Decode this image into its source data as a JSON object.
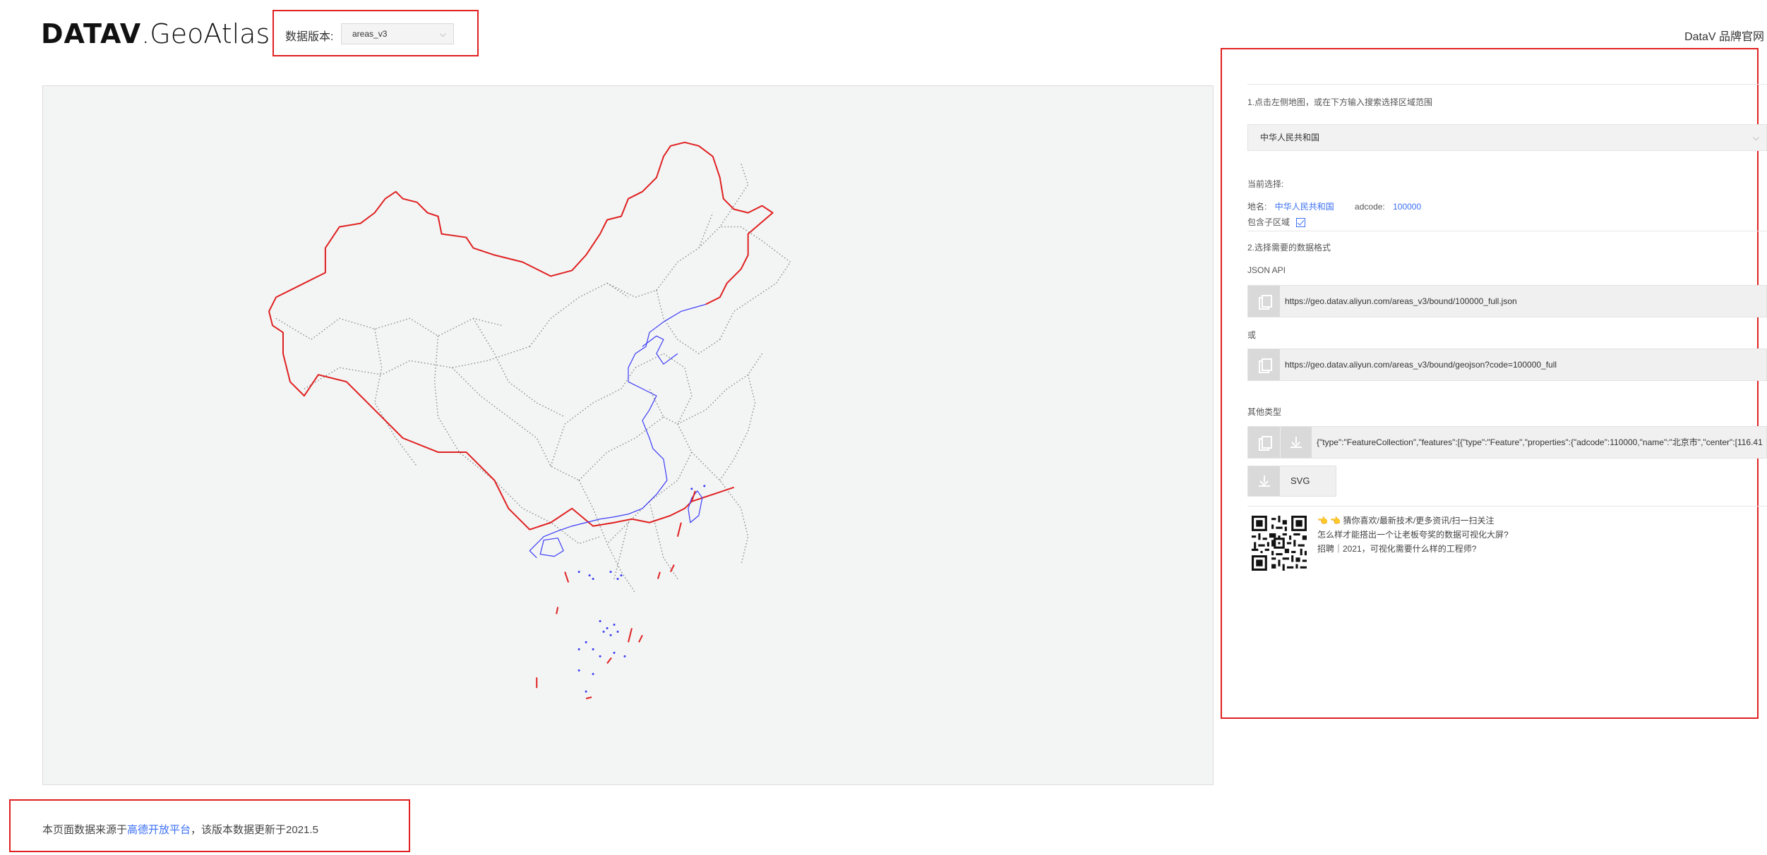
{
  "header": {
    "logo_bold": "DATAV",
    "logo_light": ".GeoAtlas",
    "version_label": "数据版本:",
    "version_value": "areas_v3",
    "brand_link": "DataV 品牌官网"
  },
  "panel": {
    "step1": "1.点击左侧地图，或在下方输入搜索选择区域范围",
    "area_select": "中华人民共和国",
    "current_label": "当前选择:",
    "name_label": "地名:",
    "name_value": "中华人民共和国",
    "adcode_label": "adcode:",
    "adcode_value": "100000",
    "include_sub": "包含子区域",
    "step2": "2.选择需要的数据格式",
    "json_api_label": "JSON API",
    "url1": "https://geo.datav.aliyun.com/areas_v3/bound/100000_full.json",
    "or_label": "或",
    "url2": "https://geo.datav.aliyun.com/areas_v3/bound/geojson?code=100000_full",
    "other_types": "其他类型",
    "geojson_preview": "{\"type\":\"FeatureCollection\",\"features\":[{\"type\":\"Feature\",\"properties\":{\"adcode\":110000,\"name\":\"北京市\",\"center\":[116.41",
    "svg_label": "SVG",
    "promo_line1": "👈 👈 猜你喜欢/最新技术/更多资讯/扫一扫关注",
    "promo_line2": "怎么样才能搭出一个让老板夸奖的数据可视化大屏?",
    "promo_line3": "招聘｜2021，可视化需要什么样的工程师?"
  },
  "footer": {
    "prefix": "本页面数据来源于",
    "link": "高德开放平台",
    "suffix": "，该版本数据更新于2021.5"
  },
  "colors": {
    "border_red": "#e02020",
    "coast_blue": "#3b3bf5",
    "link_blue": "#3b6ff5",
    "map_bg": "#f3f5f5"
  }
}
